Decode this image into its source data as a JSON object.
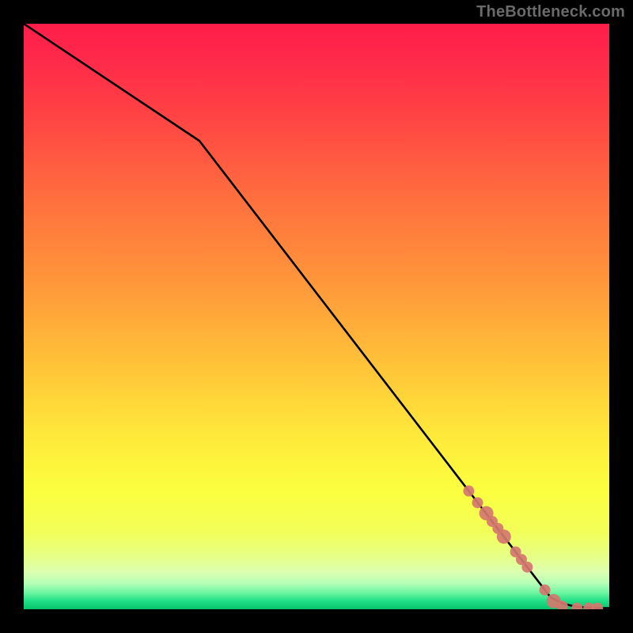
{
  "watermark": "TheBottleneck.com",
  "chart_data": {
    "type": "line",
    "title": "",
    "xlabel": "",
    "ylabel": "",
    "xlim": [
      0,
      100
    ],
    "ylim": [
      0,
      100
    ],
    "grid": false,
    "series": [
      {
        "name": "curve",
        "x": [
          0,
          30,
          90,
          92,
          94,
          96,
          98,
          100
        ],
        "y": [
          100,
          80,
          2,
          1,
          0.5,
          0.3,
          0.2,
          0.2
        ]
      }
    ],
    "markers": {
      "name": "highlight-points",
      "x": [
        76,
        77.5,
        79,
        80,
        81,
        82,
        84,
        85,
        86,
        89,
        90.5,
        92,
        94.5,
        96.5,
        98
      ],
      "y": [
        20.2,
        18.2,
        16.4,
        15.0,
        13.8,
        12.4,
        9.8,
        8.5,
        7.2,
        3.3,
        1.4,
        0.5,
        0.2,
        0.2,
        0.2
      ],
      "weight": [
        1,
        1,
        2,
        1,
        1,
        2,
        1,
        1,
        1,
        1,
        2,
        1,
        1,
        1,
        1
      ]
    },
    "colors": {
      "line": "#000000",
      "marker": "#d4776f",
      "gradient_stops": [
        {
          "offset": 0.0,
          "color": "#ff1e49"
        },
        {
          "offset": 0.06,
          "color": "#ff294a"
        },
        {
          "offset": 0.16,
          "color": "#ff4444"
        },
        {
          "offset": 0.3,
          "color": "#ff6f3e"
        },
        {
          "offset": 0.45,
          "color": "#ff993a"
        },
        {
          "offset": 0.58,
          "color": "#ffc238"
        },
        {
          "offset": 0.7,
          "color": "#ffe83a"
        },
        {
          "offset": 0.8,
          "color": "#fbff3f"
        },
        {
          "offset": 0.87,
          "color": "#f2ff5a"
        },
        {
          "offset": 0.91,
          "color": "#e6ff86"
        },
        {
          "offset": 0.935,
          "color": "#ddffb0"
        },
        {
          "offset": 0.955,
          "color": "#b8ffb8"
        },
        {
          "offset": 0.972,
          "color": "#6cf5a0"
        },
        {
          "offset": 0.985,
          "color": "#23e187"
        },
        {
          "offset": 1.0,
          "color": "#05c46b"
        }
      ]
    }
  }
}
